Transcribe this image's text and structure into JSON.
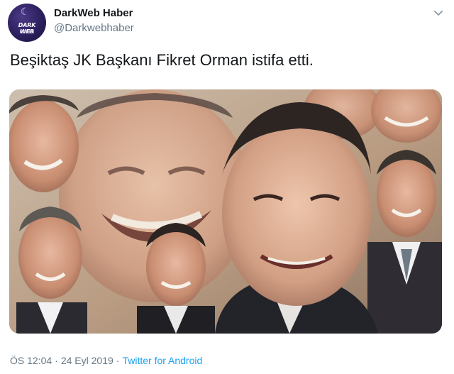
{
  "author": {
    "name": "DarkWeb Haber",
    "handle": "@Darkwebhaber",
    "avatar_text_line1": "DARK WEB",
    "avatar_text_line2": "HABER",
    "avatar_icon": "moon-logo-icon"
  },
  "tweet": {
    "text": "Beşiktaş JK Başkanı Fikret Orman istifa etti.",
    "menu_icon": "chevron-down-icon"
  },
  "media": {
    "description_icon": "photo-collage"
  },
  "meta": {
    "time": "ÖS 12:04",
    "separator": "·",
    "date": "24 Eyl 2019",
    "source": "Twitter for Android"
  },
  "colors": {
    "text": "#14171a",
    "secondary": "#657786",
    "link": "#1da1f2",
    "avatar_bg": "#2c1f5e"
  }
}
